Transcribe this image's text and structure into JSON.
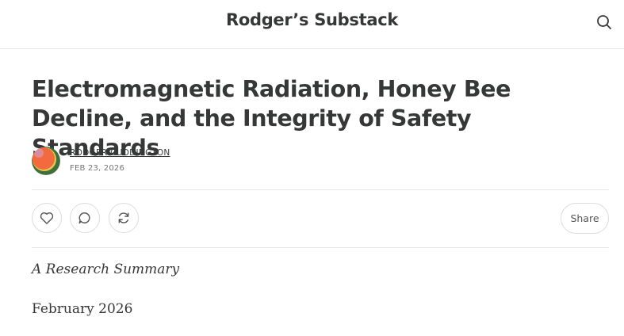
{
  "header": {
    "publication_title": "Rodger’s Substack",
    "search_icon": "search-icon"
  },
  "post": {
    "title": "Electromagnetic Radiation, Honey Bee Decline, and the Integrity of Safety Standards",
    "author": "RODGER CUDDINGTON",
    "date": "FEB 23, 2026"
  },
  "actions": {
    "like_icon": "heart-icon",
    "comment_icon": "comment-icon",
    "restack_icon": "restack-icon",
    "share_label": "Share"
  },
  "body": {
    "subtitle": "A Research Summary",
    "paragraph_1": "February 2026"
  },
  "colors": {
    "text": "#363737",
    "muted": "#757575",
    "border": "#e6e6e6",
    "avatar_orange": "#f26a3d"
  }
}
